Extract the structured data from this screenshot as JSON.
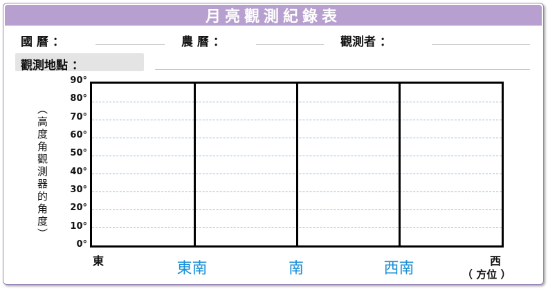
{
  "title": "月亮觀測紀錄表",
  "fields": {
    "gregorian_date": "國 曆 ：",
    "lunar_date": "農 曆 ：",
    "observer": "觀測者 ：",
    "location": "觀測地點 ："
  },
  "chart_data": {
    "type": "table",
    "ylabel": "（高度角觀測器的角度）",
    "y_ticks": [
      "90°",
      "80°",
      "70°",
      "60°",
      "50°",
      "40°",
      "30°",
      "20°",
      "10°",
      "0°"
    ],
    "x_labels": [
      {
        "text": "東",
        "color": "#111111"
      },
      {
        "text": "東南",
        "color": "#1a8fd6"
      },
      {
        "text": "南",
        "color": "#1a8fd6"
      },
      {
        "text": "西南",
        "color": "#1a8fd6"
      },
      {
        "text": "西",
        "color": "#111111"
      }
    ],
    "x_axis_note": "（ 方位 ）",
    "ylim": [
      0,
      90
    ],
    "grid": true
  },
  "colors": {
    "title_bar": "#b7a0cf",
    "grid_dash": "#8fb8e0",
    "direction_blue": "#1a8fd6"
  }
}
